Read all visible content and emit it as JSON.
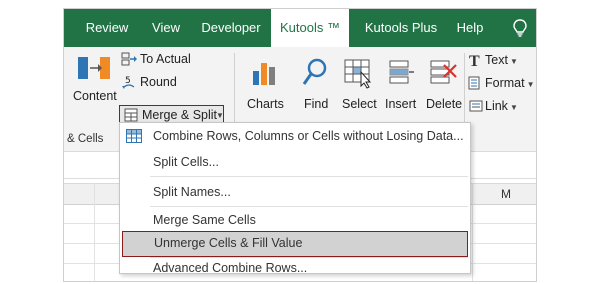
{
  "tabs": [
    {
      "label": "Review"
    },
    {
      "label": "View"
    },
    {
      "label": "Developer"
    },
    {
      "label": "Kutools ™"
    },
    {
      "label": "Kutools Plus"
    },
    {
      "label": "Help"
    }
  ],
  "active_tab": "Kutools ™",
  "help_icon": "lightbulb-icon",
  "ribbon": {
    "content_label": "Content",
    "to_actual_label": "To Actual",
    "round_label": "Round",
    "merge_split_label": "Merge & Split",
    "charts_label": "Charts",
    "find_label": "Find",
    "select_label": "Select",
    "insert_label": "Insert",
    "delete_label": "Delete",
    "text_label": "Text",
    "format_label": "Format",
    "link_label": "Link"
  },
  "group_label": "& Cells",
  "column_header": "M",
  "menu": {
    "items": [
      {
        "label": "Combine Rows, Columns or Cells without Losing Data...",
        "icon": "grid-combine-icon"
      },
      {
        "label": "Split Cells..."
      },
      {
        "label": "Split Names..."
      },
      {
        "label": "Merge Same Cells"
      },
      {
        "label": "Unmerge Cells & Fill Value",
        "highlighted": true
      },
      {
        "label": "Advanced Combine Rows..."
      }
    ]
  },
  "colors": {
    "tab_bar": "#217346",
    "highlight_border": "#8b1a1a",
    "highlight_fill": "#d2d2d2"
  }
}
